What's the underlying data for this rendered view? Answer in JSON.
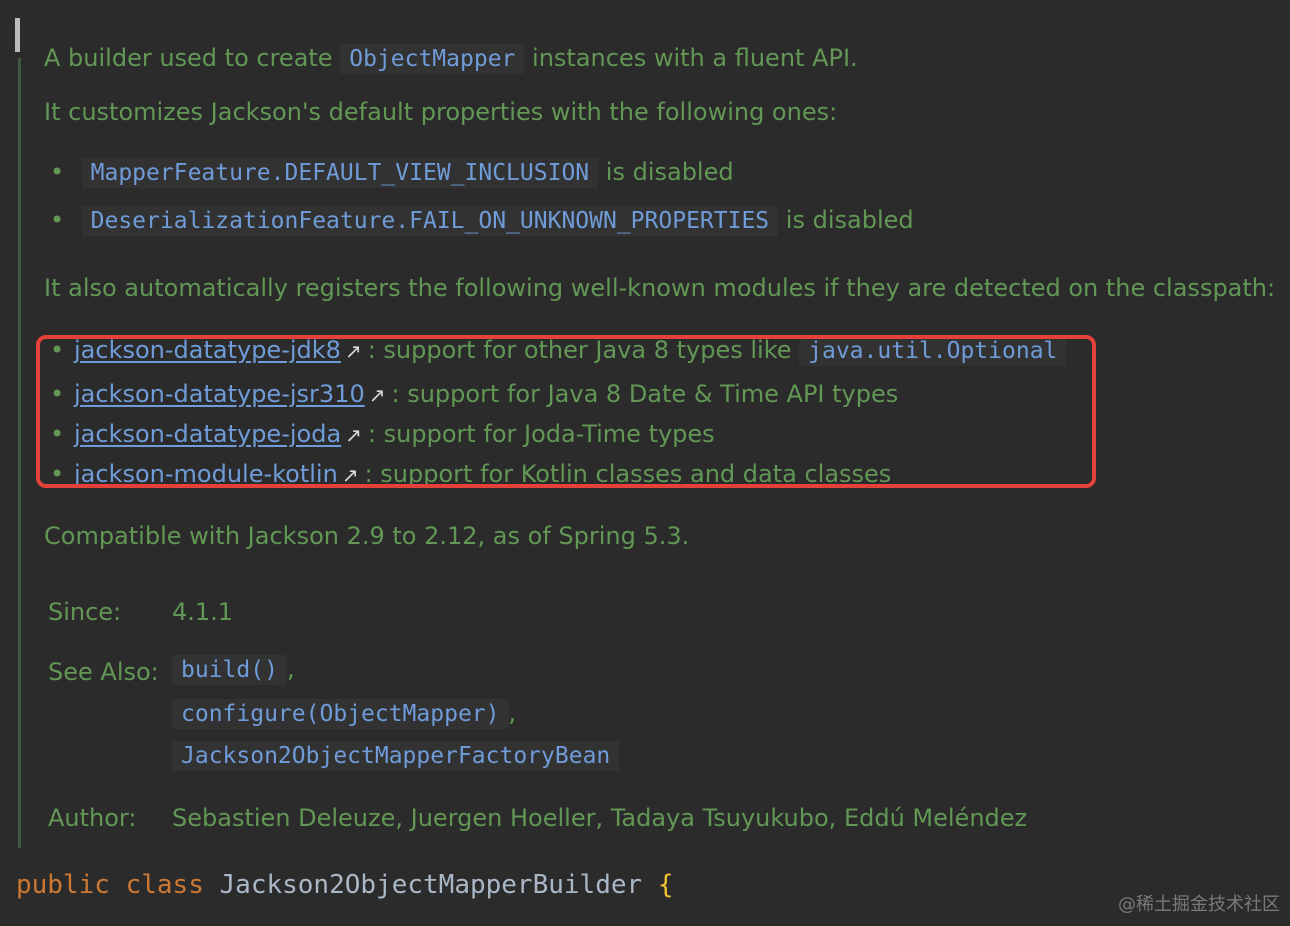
{
  "doc": {
    "intro": {
      "before": "A builder used to create",
      "code": "ObjectMapper",
      "after": "instances with a fluent API."
    },
    "customizes": "It customizes Jackson's default properties with the following ones:",
    "features": [
      {
        "code": "MapperFeature.DEFAULT_VIEW_INCLUSION",
        "suffix": "is disabled"
      },
      {
        "code": "DeserializationFeature.FAIL_ON_UNKNOWN_PROPERTIES",
        "suffix": "is disabled"
      }
    ],
    "registers": "It also automatically registers the following well-known modules if they are detected on the classpath:",
    "modules": [
      {
        "name": "jackson-datatype-jdk8",
        "desc": ": support for other Java 8 types like",
        "code": "java.util.Optional"
      },
      {
        "name": "jackson-datatype-jsr310",
        "desc": ": support for Java 8 Date & Time API types"
      },
      {
        "name": "jackson-datatype-joda",
        "desc": ": support for Joda-Time types"
      },
      {
        "name": "jackson-module-kotlin",
        "desc": ": support for Kotlin classes and data classes"
      }
    ],
    "compatible": "Compatible with Jackson 2.9 to 2.12, as of Spring 5.3.",
    "since": {
      "label": "Since:",
      "value": "4.1.1"
    },
    "see_also": {
      "label": "See Also:",
      "links": [
        {
          "text": "build()",
          "sep": ","
        },
        {
          "text": "configure(ObjectMapper)",
          "sep": ","
        },
        {
          "text": "Jackson2ObjectMapperFactoryBean",
          "sep": ""
        }
      ]
    },
    "author": {
      "label": "Author:",
      "value": "Sebastien Deleuze, Juergen Hoeller, Tadaya Tsuyukubo, Eddú Meléndez"
    }
  },
  "code": {
    "keyword_public": "public",
    "keyword_class": "class",
    "class_name": "Jackson2ObjectMapperBuilder",
    "brace": "{"
  },
  "watermark": "@稀土掘金技术社区",
  "icons": {
    "bullet": "•",
    "external_link": "↗"
  },
  "colors": {
    "background": "#2b2b2b",
    "doc_text": "#629755",
    "link": "#6f9cd9",
    "keyword": "#cc7832",
    "identifier": "#a9b7c6",
    "brace": "#f1c232",
    "highlight": "#e5413b"
  }
}
